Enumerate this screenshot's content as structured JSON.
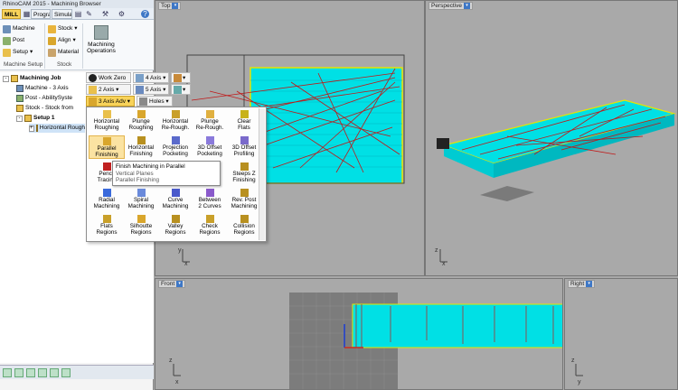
{
  "app": {
    "title": "RhinoCAM 2015 - Machining Browser",
    "tabs": [
      "MILL",
      "Program",
      "Simulate"
    ],
    "active_tab": "MILL"
  },
  "ribbon": {
    "machine": "Machine",
    "post": "Post",
    "setup": "Setup",
    "stock": "Stock",
    "align": "Align",
    "material": "Material",
    "machining_operations": "Machining Operations",
    "group_machine_setup": "Machine Setup",
    "group_stock": "Stock"
  },
  "tree": {
    "root": "Machining Job",
    "machine": "Machine - 3 Axis",
    "post": "Post - AbilitySyste",
    "stock": "Stock - Stock from",
    "setup": "Setup 1",
    "op": "Horizontal Rough"
  },
  "quick_toolbar": {
    "work_zero": "Work Zero",
    "four_axis": "4 Axis",
    "two_axis": "2 Axis",
    "five_axis": "5 Axis",
    "three_axis_adv": "3 Axis Adv",
    "holes": "Holes"
  },
  "menu": {
    "items": [
      "Horizontal\nRoughing",
      "Plunge\nRoughing",
      "Horizontal\nRe-Rough.",
      "Plunge\nRe-Rough.",
      "Clear\nFlats",
      "Parallel\nFinishing",
      "Horizontal\nFinishing",
      "Projection\nPocketing",
      "3D Offset\nPocketing",
      "3D Offset\nProfiling",
      "Pencil\nTracing",
      "Parallel\nFinishing",
      "",
      "",
      "Steeps Z\nFinishing",
      "Radial\nMachining",
      "Spiral\nMachining",
      "Curve\nMachining",
      "Between\n2 Curves",
      "Rev. Post\nMachining",
      "Flats\nRegions",
      "Silhoutte\nRegions",
      "Valley\nRegions",
      "Check\nRegions",
      "Collision\nRegions"
    ],
    "tooltip": {
      "title": "Finish Machining in Parallel",
      "line2": "Vertical Planes",
      "line3": "Parallel Finishing"
    }
  },
  "viewports": {
    "top": "Top",
    "perspective": "Perspective",
    "front": "Front",
    "right": "Right",
    "axis_x": "x",
    "axis_y": "y",
    "axis_z": "z"
  },
  "colors": {
    "model": "#00e5e8",
    "toolpath": "#c01818",
    "stock_outline": "#e6e600",
    "highlight": "#f8d35a"
  }
}
